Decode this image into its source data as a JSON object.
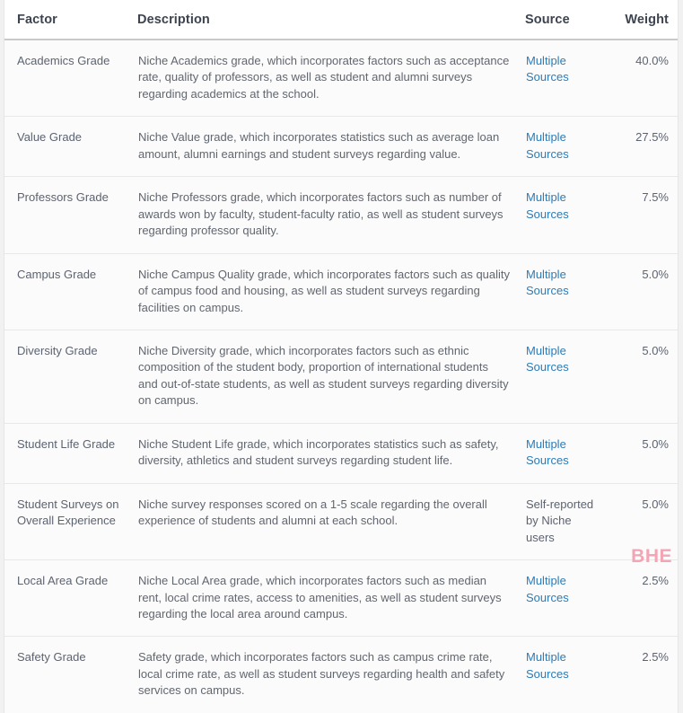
{
  "table": {
    "columns": [
      {
        "key": "factor",
        "label": "Factor"
      },
      {
        "key": "description",
        "label": "Description"
      },
      {
        "key": "source",
        "label": "Source"
      },
      {
        "key": "weight",
        "label": "Weight"
      }
    ],
    "rows": [
      {
        "factor": "Academics Grade",
        "description": "Niche Academics grade, which incorporates factors such as acceptance rate, quality of professors, as well as student and alumni surveys regarding academics at the school.",
        "source": "Multiple Sources",
        "source_is_link": true,
        "weight": "40.0%"
      },
      {
        "factor": "Value Grade",
        "description": "Niche Value grade, which incorporates statistics such as average loan amount, alumni earnings and student surveys regarding value.",
        "source": "Multiple Sources",
        "source_is_link": true,
        "weight": "27.5%"
      },
      {
        "factor": "Professors Grade",
        "description": "Niche Professors grade, which incorporates factors such as number of awards won by faculty, student-faculty ratio, as well as student surveys regarding professor quality.",
        "source": "Multiple Sources",
        "source_is_link": true,
        "weight": "7.5%"
      },
      {
        "factor": "Campus Grade",
        "description": "Niche Campus Quality grade, which incorporates factors such as quality of campus food and housing, as well as student surveys regarding facilities on campus.",
        "source": "Multiple Sources",
        "source_is_link": true,
        "weight": "5.0%"
      },
      {
        "factor": "Diversity Grade",
        "description": "Niche Diversity grade, which incorporates factors such as ethnic composition of the student body, proportion of international students and out-of-state students, as well as student surveys regarding diversity on campus.",
        "source": "Multiple Sources",
        "source_is_link": true,
        "weight": "5.0%"
      },
      {
        "factor": "Student Life Grade",
        "description": "Niche Student Life grade, which incorporates statistics such as safety, diversity, athletics and student surveys regarding student life.",
        "source": "Multiple Sources",
        "source_is_link": true,
        "weight": "5.0%"
      },
      {
        "factor": "Student Surveys on Overall Experience",
        "description": "Niche survey responses scored on a 1-5 scale regarding the overall experience of students and alumni at each school.",
        "source": "Self-reported by Niche users",
        "source_is_link": false,
        "weight": "5.0%"
      },
      {
        "factor": "Local Area Grade",
        "description": "Niche Local Area grade, which incorporates factors such as median rent, local crime rates, access to amenities, as well as student surveys regarding the local area around campus.",
        "source": "Multiple Sources",
        "source_is_link": true,
        "weight": "2.5%"
      },
      {
        "factor": "Safety Grade",
        "description": "Safety grade, which incorporates factors such as campus crime rate, local crime rate, as well as student surveys regarding health and safety services on campus.",
        "source": "Multiple Sources",
        "source_is_link": true,
        "weight": "2.5%"
      }
    ]
  },
  "watermark": {
    "text": "BHE",
    "color": "#f3a4b5"
  },
  "colors": {
    "link": "#2c7cb8",
    "header_text": "#3d4450",
    "body_text": "#5c6370",
    "row_bg": "#fbfbfb",
    "header_bg": "#ffffff",
    "row_divider": "#e8e8e8",
    "header_divider": "#c9c9c9",
    "page_bg": "#f1f1f1"
  }
}
